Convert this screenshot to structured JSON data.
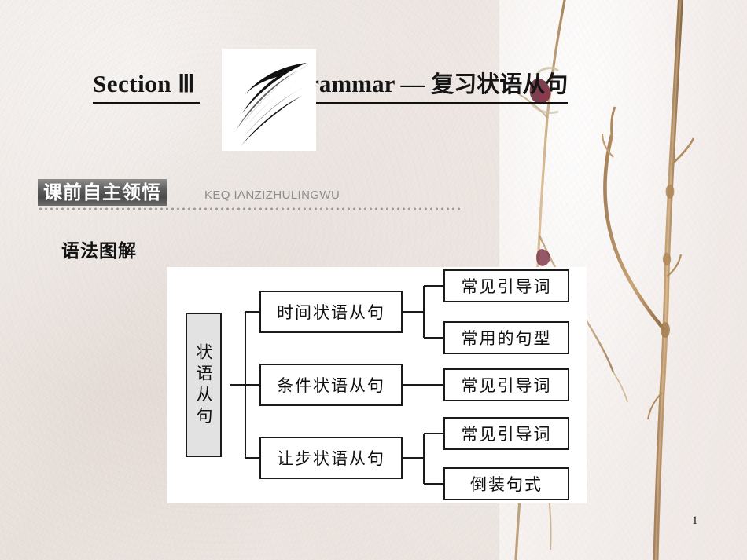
{
  "slide": {
    "page_number": "1",
    "accent_dark": "#4a4a4a",
    "panel_bg": "#ffffff",
    "root_fill": "#e2e2e2"
  },
  "header": {
    "section_label": "Section Ⅲ",
    "title_en": "Grammar —",
    "title_cn": "复习状语从句",
    "logo_icon": "swoosh-arrow-icon"
  },
  "badge": {
    "label": "课前自主领悟",
    "pinyin": "KEQ IANZIZHULINGWU"
  },
  "subheading": {
    "text": "语法图解"
  },
  "chart_data": {
    "type": "diagram",
    "title": "语法图解",
    "orientation": "left-to-right tree",
    "root": {
      "label": "状语从句",
      "fill": "#e2e2e2",
      "vertical_text": true
    },
    "branches": [
      {
        "label": "时间状语从句",
        "children": [
          {
            "label": "常见引导词"
          },
          {
            "label": "常用的句型"
          }
        ]
      },
      {
        "label": "条件状语从句",
        "children": [
          {
            "label": "常见引导词"
          }
        ]
      },
      {
        "label": "让步状语从句",
        "children": [
          {
            "label": "常见引导词"
          },
          {
            "label": "倒装句式"
          }
        ]
      }
    ]
  }
}
